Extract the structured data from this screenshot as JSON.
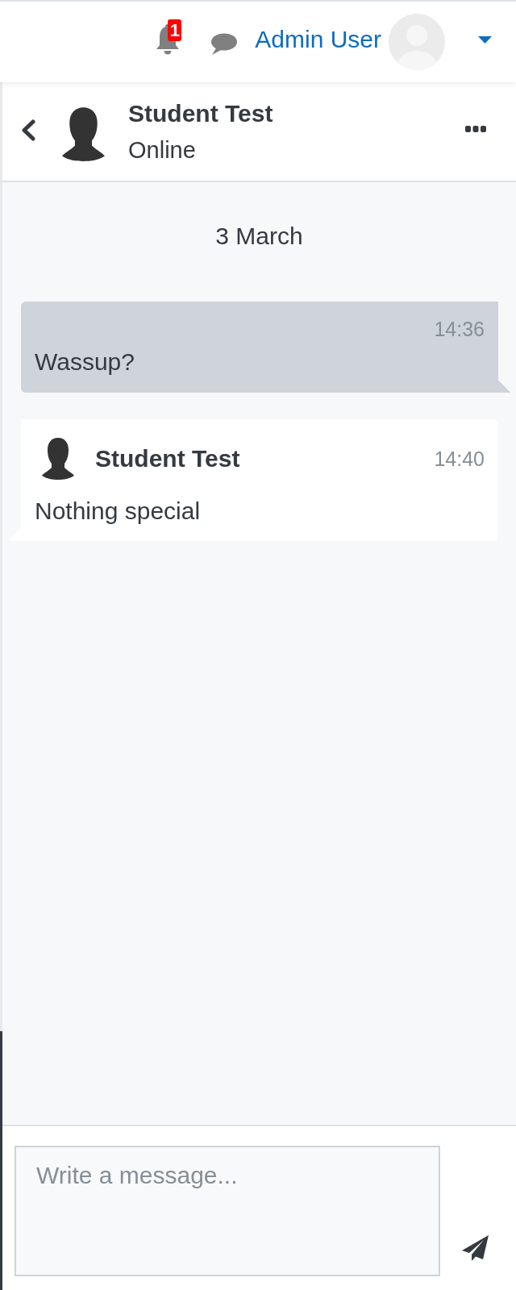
{
  "navbar": {
    "notification_count": "1",
    "user_name": "Admin User"
  },
  "conversation": {
    "contact_name": "Student Test",
    "contact_status": "Online"
  },
  "date_divider": "3 March",
  "messages": [
    {
      "kind": "sent",
      "time": "14:36",
      "text": "Wassup?"
    },
    {
      "kind": "received",
      "sender": "Student Test",
      "time": "14:40",
      "text": "Nothing special"
    }
  ],
  "composer": {
    "placeholder": "Write a message..."
  }
}
